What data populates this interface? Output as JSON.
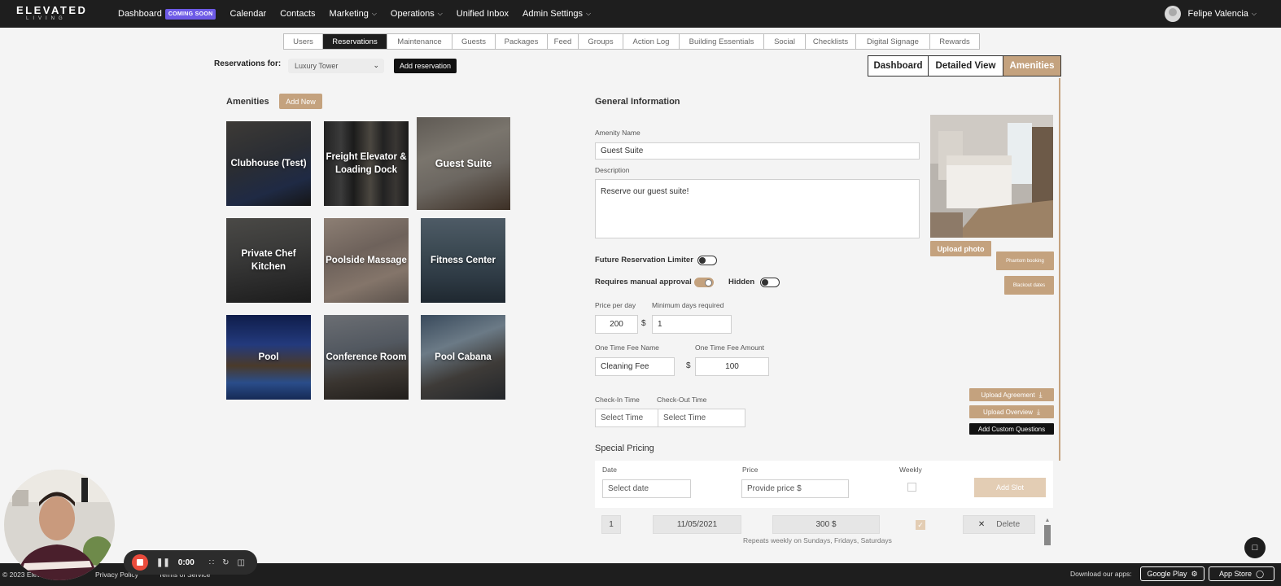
{
  "topbar": {
    "logo_main": "ELEVATED",
    "logo_sub": "LIVING",
    "nav": [
      {
        "label": "Dashboard",
        "badge": "COMING SOON"
      },
      {
        "label": "Calendar"
      },
      {
        "label": "Contacts"
      },
      {
        "label": "Marketing",
        "dropdown": true
      },
      {
        "label": "Operations",
        "dropdown": true
      },
      {
        "label": "Unified Inbox"
      },
      {
        "label": "Admin Settings",
        "dropdown": true
      }
    ],
    "user_name": "Felipe Valencia"
  },
  "subtabs": [
    {
      "label": "Users",
      "active": false
    },
    {
      "label": "Reservations",
      "active": true
    },
    {
      "label": "Maintenance",
      "active": false
    },
    {
      "label": "Guests",
      "active": false
    },
    {
      "label": "Packages",
      "active": false
    },
    {
      "label": "Feed",
      "active": false
    },
    {
      "label": "Groups",
      "active": false
    },
    {
      "label": "Action Log",
      "active": false
    },
    {
      "label": "Building Essentials",
      "active": false
    },
    {
      "label": "Social",
      "active": false
    },
    {
      "label": "Checklists",
      "active": false
    },
    {
      "label": "Digital Signage",
      "active": false
    },
    {
      "label": "Rewards",
      "active": false
    }
  ],
  "reservations": {
    "label": "Reservations for:",
    "building": "Luxury Tower",
    "add_button": "Add reservation"
  },
  "view_toggle": [
    {
      "label": "Dashboard",
      "active": false
    },
    {
      "label": "Detailed View",
      "active": false
    },
    {
      "label": "Amenities",
      "active": true
    }
  ],
  "amenities": {
    "title": "Amenities",
    "add_new": "Add New",
    "tiles": [
      {
        "name": "Clubhouse (Test)",
        "selected": false
      },
      {
        "name": "Freight Elevator & Loading Dock",
        "selected": false
      },
      {
        "name": "Guest Suite",
        "selected": true
      },
      {
        "name": "Private Chef Kitchen",
        "selected": false
      },
      {
        "name": "Poolside Massage",
        "selected": false
      },
      {
        "name": "Fitness Center",
        "selected": false
      },
      {
        "name": "Pool",
        "selected": false
      },
      {
        "name": "Conference Room",
        "selected": false
      },
      {
        "name": "Pool Cabana",
        "selected": false
      }
    ]
  },
  "general": {
    "title": "General Information",
    "amenity_name_label": "Amenity Name",
    "amenity_name": "Guest Suite",
    "description_label": "Description",
    "description": "Reserve our guest suite!",
    "upload_photo": "Upload photo",
    "phantom_booking": "Phantom booking",
    "blackout_dates": "Blackout dates",
    "future_limiter_label": "Future Reservation Limiter",
    "future_limiter_on": false,
    "manual_approval_label": "Requires manual approval",
    "manual_approval_on": true,
    "hidden_label": "Hidden",
    "hidden_on": false,
    "price_label": "Price per day",
    "price": "200",
    "currency": "$",
    "min_days_label": "Minimum days required",
    "min_days": "1",
    "fee_name_label": "One Time Fee Name",
    "fee_name": "Cleaning Fee",
    "fee_amount_label": "One Time Fee Amount",
    "fee_amount": "100",
    "checkin_label": "Check-In Time",
    "checkin_placeholder": "Select Time",
    "checkout_label": "Check-Out Time",
    "checkout_placeholder": "Select Time",
    "upload_agreement": "Upload Agreement",
    "upload_overview": "Upload Overview",
    "add_custom_questions": "Add Custom Questions"
  },
  "special_pricing": {
    "title": "Special Pricing",
    "date_label": "Date",
    "date_placeholder": "Select date",
    "price_label": "Price",
    "price_placeholder": "Provide price $",
    "weekly_label": "Weekly",
    "add_slot": "Add Slot",
    "rows": [
      {
        "index": "1",
        "date": "11/05/2021",
        "price": "300 $",
        "weekly": true,
        "delete": "Delete",
        "repeat_note": "Repeats weekly on Sundays, Fridays, Saturdays"
      }
    ]
  },
  "footer": {
    "copyright": "© 2023 Elevated Living",
    "privacy": "Privacy Policy",
    "terms": "Terms of Service",
    "download": "Download our apps:",
    "google_play": "Google Play",
    "app_store": "App Store"
  },
  "recorder": {
    "time": "0:00"
  }
}
